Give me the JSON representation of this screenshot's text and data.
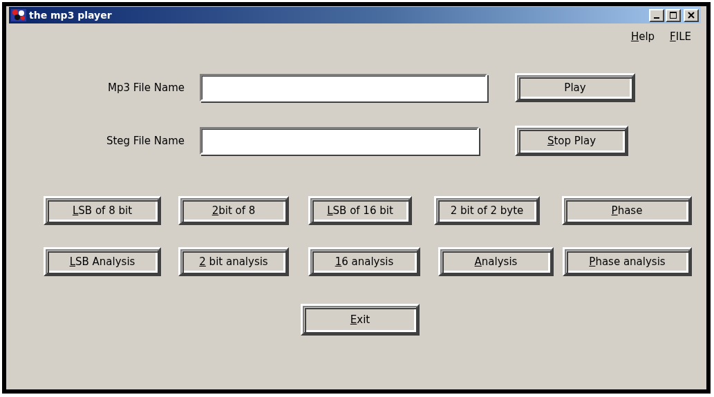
{
  "window": {
    "title": "the mp3 player"
  },
  "menu": [
    {
      "key": "H",
      "text": "elp"
    },
    {
      "key": "F",
      "text": "ILE"
    }
  ],
  "fields": [
    {
      "label": "Mp3 File Name",
      "button": {
        "text": "Play"
      }
    },
    {
      "label": "Steg File Name",
      "button": {
        "key": "S",
        "text": "top Play"
      }
    }
  ],
  "method_buttons": [
    {
      "key": "L",
      "text": "SB of 8 bit"
    },
    {
      "key": "2",
      "text": "bit of 8"
    },
    {
      "key": "L",
      "text": "SB of 16 bit"
    },
    {
      "text": "2 bit of 2 byte"
    },
    {
      "key": "P",
      "text": "hase"
    }
  ],
  "analysis_buttons": [
    {
      "key": "L",
      "text": "SB Analysis"
    },
    {
      "key": "2",
      "text": " bit analysis"
    },
    {
      "key": "1",
      "text": "6 analysis"
    },
    {
      "key": "A",
      "text": "nalysis"
    },
    {
      "key": "P",
      "text": "hase analysis"
    }
  ],
  "exit_button": {
    "key": "E",
    "text": "xit"
  }
}
